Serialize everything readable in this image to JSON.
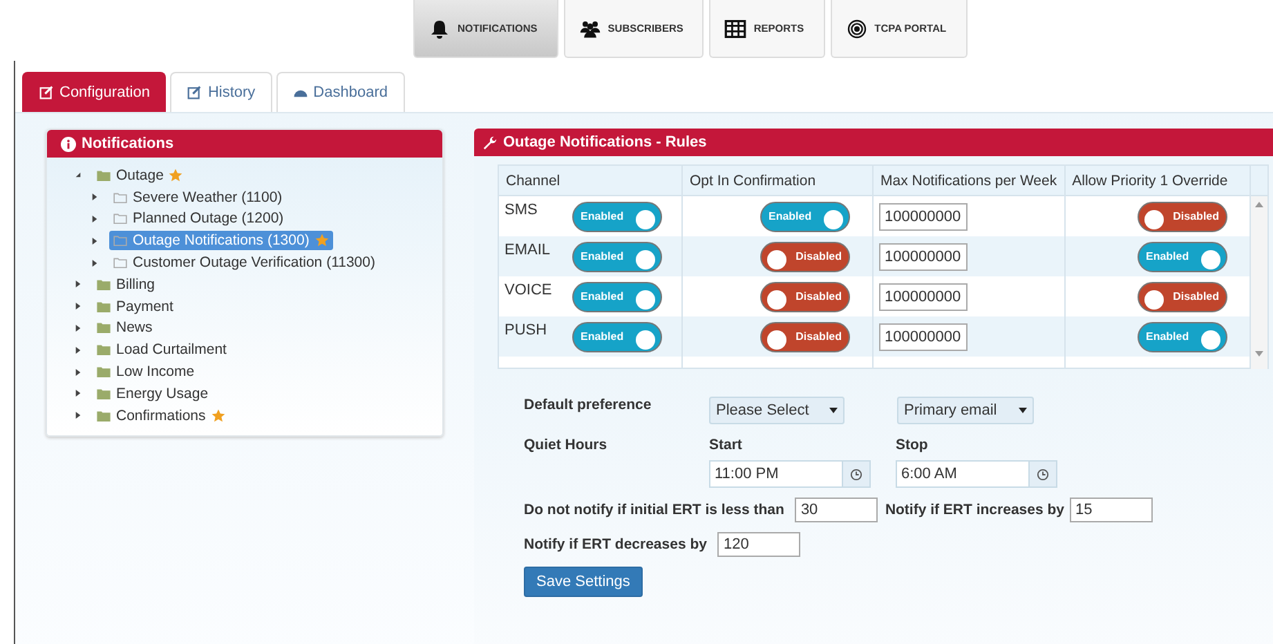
{
  "top_nav": [
    {
      "label": "NOTIFICATIONS",
      "selected": true
    },
    {
      "label": "SUBSCRIBERS",
      "selected": false
    },
    {
      "label": "REPORTS",
      "selected": false
    },
    {
      "label": "TCPA PORTAL",
      "selected": false
    }
  ],
  "tabs": [
    {
      "label": "Configuration",
      "selected": true
    },
    {
      "label": "History",
      "selected": false
    },
    {
      "label": "Dashboard",
      "selected": false
    }
  ],
  "tree": {
    "title": "Notifications",
    "items": [
      {
        "label": "Outage",
        "starred": true,
        "expanded": true,
        "selected": false,
        "children": [
          {
            "label": "Severe Weather (1100)",
            "starred": false,
            "expanded": false,
            "selected": false
          },
          {
            "label": "Planned Outage (1200)",
            "starred": false,
            "expanded": false,
            "selected": false
          },
          {
            "label": "Outage Notifications (1300)",
            "starred": true,
            "expanded": false,
            "selected": true
          },
          {
            "label": "Customer Outage Verification (11300)",
            "starred": false,
            "expanded": false,
            "selected": false
          }
        ]
      },
      {
        "label": "Billing",
        "starred": false,
        "expanded": false,
        "selected": false
      },
      {
        "label": "Payment",
        "starred": false,
        "expanded": false,
        "selected": false
      },
      {
        "label": "News",
        "starred": false,
        "expanded": false,
        "selected": false
      },
      {
        "label": "Load Curtailment",
        "starred": false,
        "expanded": false,
        "selected": false
      },
      {
        "label": "Low Income",
        "starred": false,
        "expanded": false,
        "selected": false
      },
      {
        "label": "Energy Usage",
        "starred": false,
        "expanded": false,
        "selected": false
      },
      {
        "label": "Confirmations",
        "starred": true,
        "expanded": false,
        "selected": false
      }
    ]
  },
  "rules": {
    "title": "Outage Notifications - Rules",
    "columns": [
      "Channel",
      "Opt In Confirmation",
      "Max Notifications per Week",
      "Allow Priority 1 Override"
    ],
    "rows": [
      {
        "channel": "SMS",
        "enabled": {
          "on": true,
          "label": "Enabled"
        },
        "opt_in": {
          "on": true,
          "label": "Enabled"
        },
        "max": "100000000",
        "priority": {
          "on": false,
          "label": "Disabled"
        }
      },
      {
        "channel": "EMAIL",
        "enabled": {
          "on": true,
          "label": "Enabled"
        },
        "opt_in": {
          "on": false,
          "label": "Disabled"
        },
        "max": "100000000",
        "priority": {
          "on": true,
          "label": "Enabled"
        }
      },
      {
        "channel": "VOICE",
        "enabled": {
          "on": true,
          "label": "Enabled"
        },
        "opt_in": {
          "on": false,
          "label": "Disabled"
        },
        "max": "100000000",
        "priority": {
          "on": false,
          "label": "Disabled"
        }
      },
      {
        "channel": "PUSH",
        "enabled": {
          "on": true,
          "label": "Enabled"
        },
        "opt_in": {
          "on": false,
          "label": "Disabled"
        },
        "max": "100000000",
        "priority": {
          "on": true,
          "label": "Enabled"
        }
      }
    ]
  },
  "settings": {
    "default_preference": {
      "label": "Default preference",
      "select_1": "Please Select",
      "select_2": "Primary email"
    },
    "quiet_hours": {
      "label": "Quiet Hours",
      "start_label": "Start",
      "start": "11:00 PM",
      "stop_label": "Stop",
      "stop": "6:00 AM"
    },
    "initial_ert": {
      "label": "Do not notify if initial ERT is less than",
      "value": "30"
    },
    "ert_increase": {
      "label": "Notify if ERT increases by",
      "value": "15"
    },
    "ert_decrease": {
      "label": "Notify if ERT decreases by",
      "value": "120"
    },
    "save_button": "Save Settings"
  }
}
